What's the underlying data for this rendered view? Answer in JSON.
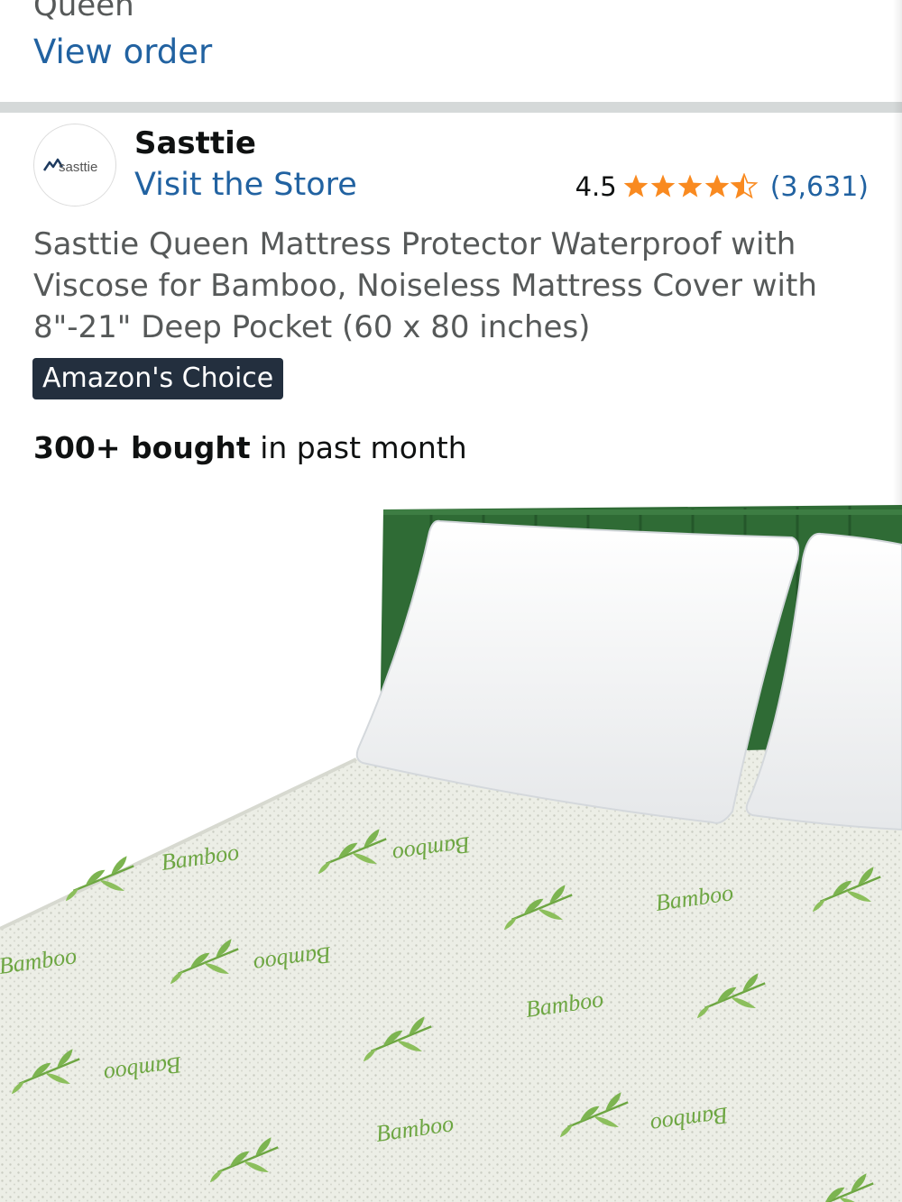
{
  "previous_item": {
    "variant": "Queen",
    "view_order_label": "View order"
  },
  "brand": {
    "logo_text": "sasttie",
    "name": "Sasttie",
    "visit_store_label": "Visit the Store"
  },
  "rating": {
    "value": "4.5",
    "stars": 4.5,
    "count": "(3,631)",
    "star_color": "#f98a20"
  },
  "product": {
    "title": "Sasttie Queen Mattress Protector Waterproof with Viscose for Bamboo, Noiseless Mattress Cover with 8\"-21\" Deep Pocket (60 x 80 inches)",
    "badge": "Amazon's Choice",
    "bought_bold": "300+ bought",
    "bought_rest": " in past month"
  },
  "image": {
    "print_text": "Bamboo",
    "headboard_color": "#2f6b35"
  },
  "colors": {
    "link": "#2162a1",
    "badge_bg": "#232f3e"
  }
}
